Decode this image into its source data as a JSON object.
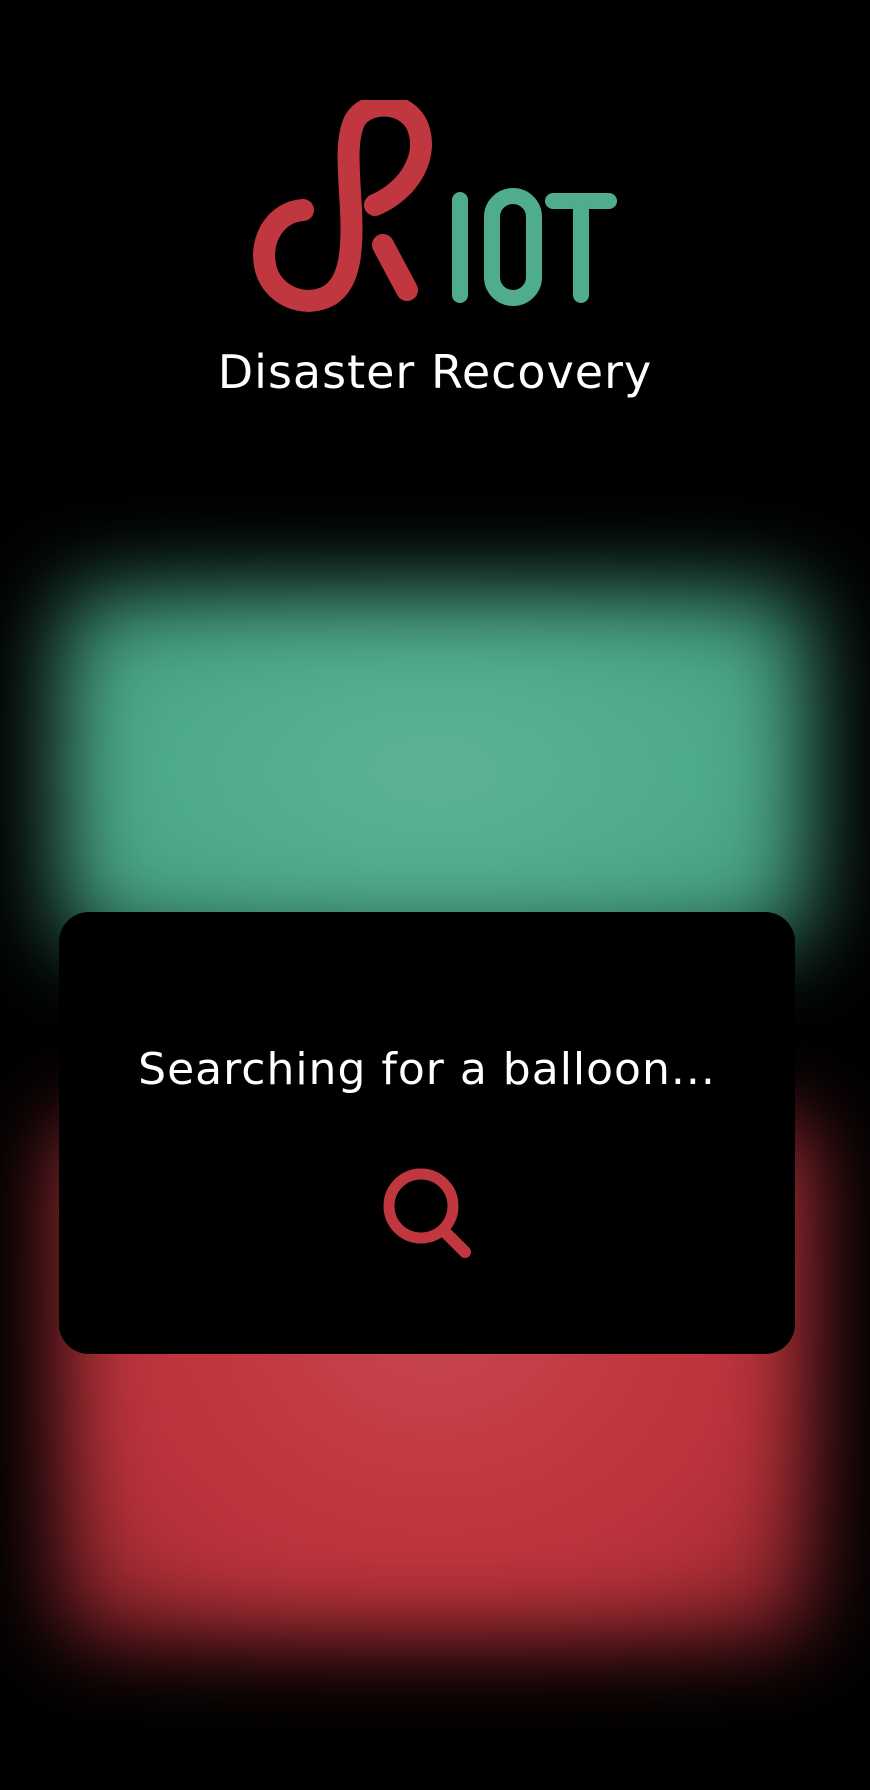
{
  "app": {
    "logo_text": "RIOT",
    "subtitle": "Disaster Recovery"
  },
  "status": {
    "message": "Searching for a balloon...",
    "icon": "search-icon"
  },
  "colors": {
    "brand_red": "#c1373f",
    "brand_green": "#4fac8c",
    "background": "#000000",
    "text": "#ffffff"
  }
}
